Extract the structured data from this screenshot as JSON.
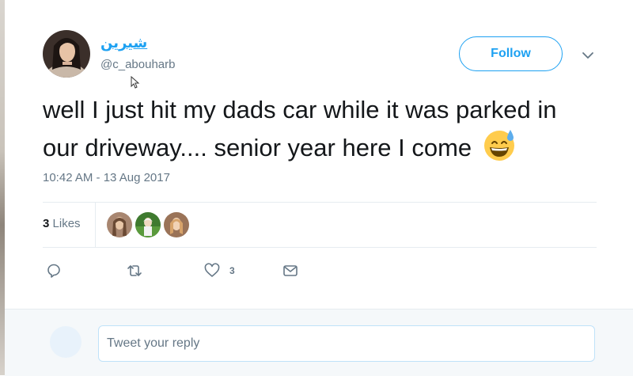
{
  "user": {
    "display_name": "شيرين",
    "handle": "@c_abouharb"
  },
  "header": {
    "follow_label": "Follow"
  },
  "tweet": {
    "text": "well I just hit my dads car while it was parked in our driveway.... senior year here I come",
    "emoji": "grinning-face-with-sweat-icon",
    "timestamp": "10:42 AM - 13 Aug 2017"
  },
  "stats": {
    "likes_count": "3",
    "likes_label": "Likes"
  },
  "actions": {
    "like_count": "3"
  },
  "reply": {
    "placeholder": "Tweet your reply"
  },
  "colors": {
    "accent": "#1da1f2",
    "secondary_text": "#657786",
    "divider": "#e6ecf0"
  }
}
